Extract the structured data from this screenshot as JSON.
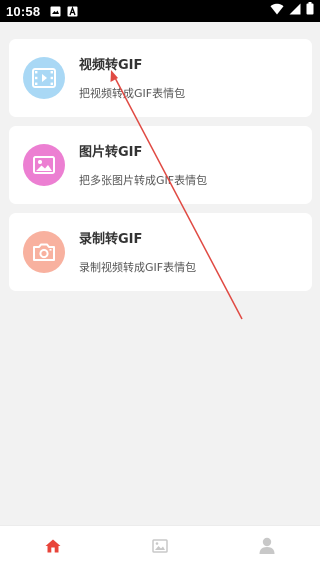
{
  "status_bar": {
    "time": "10:58",
    "left_icons": [
      "image-icon",
      "a-icon"
    ],
    "right_icons": [
      "wifi-icon",
      "signal-icon",
      "battery-icon"
    ]
  },
  "cards": [
    {
      "title": "视频转GIF",
      "description": "把视频转成GIF表情包",
      "icon": "video-film-icon",
      "color": "#a9d8f5"
    },
    {
      "title": "图片转GIF",
      "description": "把多张图片转成GIF表情包",
      "icon": "picture-icon",
      "color": "#ec7fd2"
    },
    {
      "title": "录制转GIF",
      "description": "录制视频转成GIF表情包",
      "icon": "camera-icon",
      "color": "#f8b19f"
    }
  ],
  "bottom_nav": {
    "items": [
      {
        "icon": "home-icon",
        "active": true
      },
      {
        "icon": "image-icon",
        "active": false
      },
      {
        "icon": "user-icon",
        "active": false
      }
    ],
    "active_color": "#e8443a",
    "inactive_color": "#c8c8c8"
  },
  "annotation": {
    "color": "#e04a43"
  }
}
